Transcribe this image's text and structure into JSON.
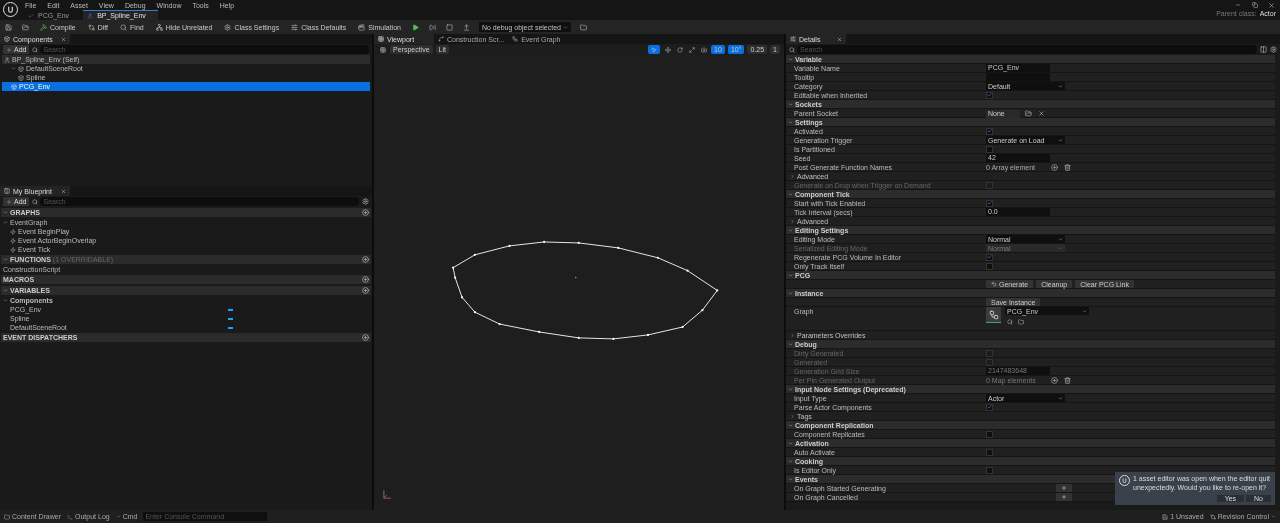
{
  "menu": [
    "File",
    "Edit",
    "Asset",
    "View",
    "Debug",
    "Window",
    "Tools",
    "Help"
  ],
  "parent_class": {
    "label": "Parent class:",
    "value": "Actor"
  },
  "asset_tabs": [
    {
      "label": "PCG_Env",
      "selected": false
    },
    {
      "label": "BP_Spline_Env",
      "selected": true
    }
  ],
  "toolbar": [
    {
      "kind": "compile",
      "label": "Compile"
    },
    {
      "kind": "diff",
      "label": "Diff"
    },
    {
      "kind": "find",
      "label": "Find"
    },
    {
      "kind": "hide",
      "label": "Hide Unrelated"
    },
    {
      "kind": "settings",
      "label": "Class Settings"
    },
    {
      "kind": "defaults",
      "label": "Class Defaults"
    },
    {
      "kind": "simulation",
      "label": "Simulation"
    }
  ],
  "debug_select": "No debug object selected",
  "components": {
    "title": "Components",
    "add": "Add",
    "search_placeholder": "Search",
    "tree": [
      {
        "label": "BP_Spline_Env (Self)",
        "selected": false,
        "children": [
          {
            "label": "DefaultSceneRoot",
            "selected": false,
            "children": [
              {
                "label": "Spline",
                "selected": false
              }
            ]
          },
          {
            "label": "PCG_Env",
            "selected": true
          }
        ]
      }
    ]
  },
  "my_blueprint": {
    "title": "My Blueprint",
    "add": "Add",
    "search_placeholder": "Search",
    "sections": [
      {
        "title": "GRAPHS",
        "items": [
          {
            "label": "EventGraph",
            "children": [
              {
                "label": "Event BeginPlay"
              },
              {
                "label": "Event ActorBeginOverlap"
              },
              {
                "label": "Event Tick"
              }
            ]
          }
        ]
      },
      {
        "title": "FUNCTIONS",
        "note": "(1 OVERRIDABLE)",
        "items": [
          {
            "label": "ConstructionScript"
          }
        ]
      },
      {
        "title": "MACROS"
      },
      {
        "title": "VARIABLES",
        "items": [
          {
            "label": "Components",
            "children": [
              {
                "label": "PCG_Env"
              },
              {
                "label": "Spline"
              },
              {
                "label": "DefaultSceneRoot"
              }
            ]
          }
        ]
      },
      {
        "title": "EVENT DISPATCHERS"
      }
    ]
  },
  "viewport": {
    "tabs": [
      {
        "label": "Viewport",
        "selected": true
      },
      {
        "label": "Construction Scr...",
        "selected": false
      },
      {
        "label": "Event Graph",
        "selected": false
      }
    ],
    "view_mode": "Perspective",
    "lighting": "Lit",
    "snaps": [
      "10",
      "10°",
      "0.25",
      "1"
    ]
  },
  "details": {
    "title": "Details",
    "search_placeholder": "Search",
    "rows": [
      {
        "kind": "section",
        "label": "Variable"
      },
      {
        "kind": "text",
        "label": "Variable Name",
        "value": "PCG_Env",
        "disabled": false
      },
      {
        "kind": "text",
        "label": "Tooltip",
        "value": "",
        "disabled": false
      },
      {
        "kind": "dropdown",
        "label": "Category",
        "value": "Default",
        "disabled": false
      },
      {
        "kind": "check",
        "label": "Editable when Inherited",
        "checked": true,
        "disabled": false
      },
      {
        "kind": "section",
        "label": "Sockets"
      },
      {
        "kind": "socket",
        "label": "Parent Socket",
        "value": "None"
      },
      {
        "kind": "section",
        "label": "Settings"
      },
      {
        "kind": "check",
        "label": "Activated",
        "checked": true,
        "disabled": false
      },
      {
        "kind": "dropdown",
        "label": "Generation Trigger",
        "value": "Generate on Load",
        "disabled": false
      },
      {
        "kind": "check",
        "label": "Is Partitioned",
        "checked": false,
        "disabled": false
      },
      {
        "kind": "text",
        "label": "Seed",
        "value": "42",
        "disabled": false
      },
      {
        "kind": "array",
        "label": "Post Generate Function Names",
        "value": "0 Array element",
        "disabled": false
      },
      {
        "kind": "group",
        "label": "Advanced"
      },
      {
        "kind": "check",
        "label": "Generate on Drop when Trigger on Demand",
        "checked": false,
        "disabled": true
      },
      {
        "kind": "section",
        "label": "Component Tick"
      },
      {
        "kind": "check",
        "label": "Start with Tick Enabled",
        "checked": true,
        "disabled": false
      },
      {
        "kind": "text",
        "label": "Tick Interval (secs)",
        "value": "0.0",
        "disabled": false
      },
      {
        "kind": "group",
        "label": "Advanced"
      },
      {
        "kind": "section",
        "label": "Editing Settings"
      },
      {
        "kind": "dropdown",
        "label": "Editing Mode",
        "value": "Normal",
        "disabled": false
      },
      {
        "kind": "dropdown",
        "label": "Serialized Editing Mode",
        "value": "Normal",
        "disabled": true
      },
      {
        "kind": "check",
        "label": "Regenerate PCG Volume In Editor",
        "checked": true,
        "disabled": false
      },
      {
        "kind": "check",
        "label": "Only Track Itself",
        "checked": false,
        "disabled": false
      },
      {
        "kind": "section",
        "label": "PCG"
      },
      {
        "kind": "buttons",
        "buttons": [
          "Generate",
          "Cleanup",
          "Clear PCG Link"
        ]
      },
      {
        "kind": "section",
        "label": "Instance"
      },
      {
        "kind": "button",
        "label": "Save Instance"
      },
      {
        "kind": "graph",
        "label": "Graph",
        "value": "PCG_Env"
      },
      {
        "kind": "group",
        "label": "Parameters Overrides"
      },
      {
        "kind": "section",
        "label": "Debug"
      },
      {
        "kind": "check",
        "label": "Dirty Generated",
        "checked": false,
        "disabled": true
      },
      {
        "kind": "check",
        "label": "Generated",
        "checked": false,
        "disabled": true
      },
      {
        "kind": "text",
        "label": "Generation Grid Size",
        "value": "2147483648",
        "disabled": true
      },
      {
        "kind": "array",
        "label": "Per Pin Generated Output",
        "value": "0 Map elements",
        "disabled": true
      },
      {
        "kind": "section",
        "label": "Input Node Settings (Deprecated)"
      },
      {
        "kind": "dropdown",
        "label": "Input Type",
        "value": "Actor",
        "disabled": false
      },
      {
        "kind": "check",
        "label": "Parse Actor Components",
        "checked": true,
        "disabled": false
      },
      {
        "kind": "group",
        "label": "Tags"
      },
      {
        "kind": "section",
        "label": "Component Replication"
      },
      {
        "kind": "check",
        "label": "Component Replicates",
        "checked": false,
        "disabled": false
      },
      {
        "kind": "section",
        "label": "Activation"
      },
      {
        "kind": "check",
        "label": "Auto Activate",
        "checked": false,
        "disabled": false
      },
      {
        "kind": "section",
        "label": "Cooking"
      },
      {
        "kind": "check",
        "label": "Is Editor Only",
        "checked": false,
        "disabled": false
      },
      {
        "kind": "section",
        "label": "Events"
      },
      {
        "kind": "event",
        "label": "On Graph Started Generating"
      },
      {
        "kind": "event",
        "label": "On Graph Cancelled"
      }
    ]
  },
  "notification": {
    "message": "1 asset editor was open when the editor quit unexpectedly. Would you like to re-open it?",
    "buttons": [
      "Yes",
      "No"
    ]
  },
  "status_bar": {
    "content_drawer": "Content Drawer",
    "output_log": "Output Log",
    "cmd": "Cmd",
    "console_placeholder": "Enter Console Command",
    "unsaved": "1 Unsaved",
    "revision": "Revision Control"
  }
}
